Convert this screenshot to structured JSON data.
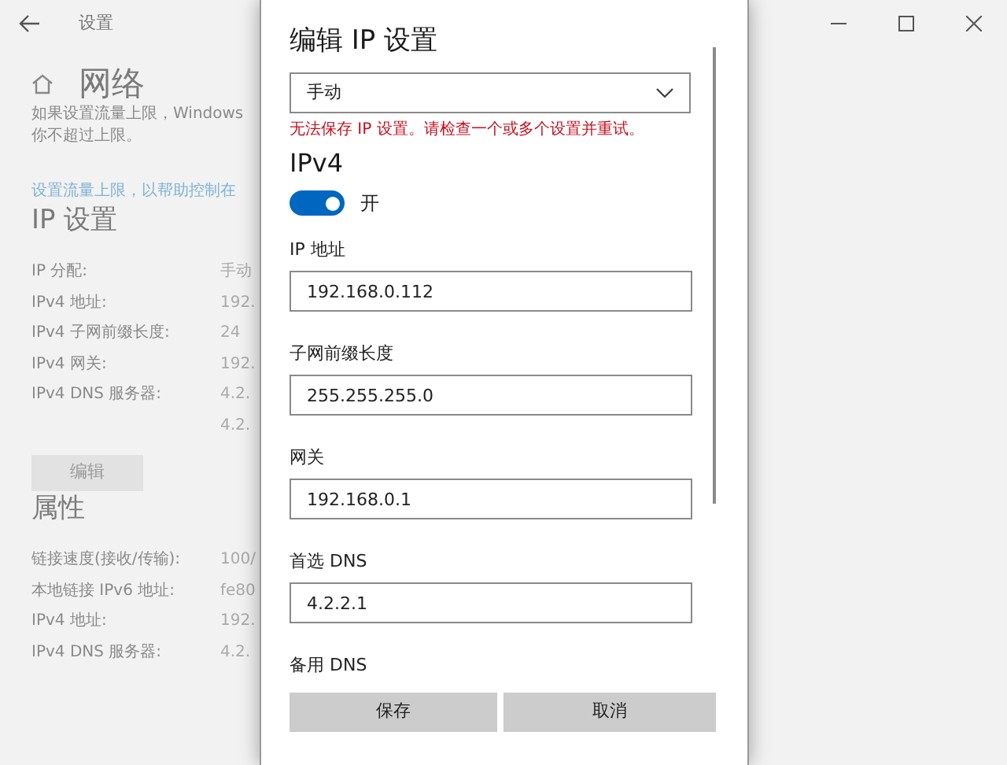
{
  "window": {
    "title": "设置"
  },
  "page": {
    "heading": "网络",
    "intro_lines": [
      "如果设置流量上限，Windows",
      "你不超过上限。"
    ],
    "link": "设置流量上限，以帮助控制在"
  },
  "ip_settings": {
    "heading": "IP 设置",
    "rows": [
      {
        "label": "IP 分配:",
        "values": [
          "手动"
        ]
      },
      {
        "label": "IPv4 地址:",
        "values": [
          "192."
        ]
      },
      {
        "label": "IPv4 子网前缀长度:",
        "values": [
          "24"
        ]
      },
      {
        "label": "IPv4 网关:",
        "values": [
          "192."
        ]
      },
      {
        "label": "IPv4 DNS 服务器:",
        "values": [
          "4.2.",
          "4.2."
        ]
      }
    ],
    "edit_button": "编辑"
  },
  "properties": {
    "heading": "属性",
    "rows": [
      {
        "label": "链接速度(接收/传输):",
        "values": [
          "100/"
        ]
      },
      {
        "label": "本地链接 IPv6 地址:",
        "values": [
          "fe80"
        ]
      },
      {
        "label": "IPv4 地址:",
        "values": [
          "192."
        ]
      },
      {
        "label": "IPv4 DNS 服务器:",
        "values": [
          "4.2."
        ]
      }
    ]
  },
  "dialog": {
    "title": "编辑 IP 设置",
    "mode_dropdown": {
      "value": "手动"
    },
    "error": "无法保存 IP 设置。请检查一个或多个设置并重试。",
    "section": "IPv4",
    "toggle": {
      "on": true,
      "label": "开"
    },
    "fields": [
      {
        "label": "IP 地址",
        "value": "192.168.0.112"
      },
      {
        "label": "子网前缀长度",
        "value": "255.255.255.0"
      },
      {
        "label": "网关",
        "value": "192.168.0.1"
      },
      {
        "label": "首选 DNS",
        "value": "4.2.2.1"
      },
      {
        "label": "备用 DNS"
      }
    ],
    "buttons": [
      "保存",
      "取消"
    ]
  }
}
